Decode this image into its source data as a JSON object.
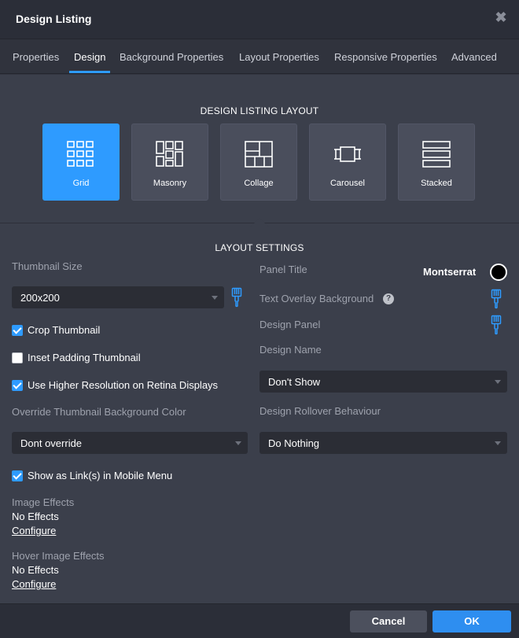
{
  "window": {
    "title": "Design Listing",
    "close_icon": "close-icon"
  },
  "tabs": [
    {
      "label": "Properties"
    },
    {
      "label": "Design"
    },
    {
      "label": "Background Properties"
    },
    {
      "label": "Layout Properties"
    },
    {
      "label": "Responsive Properties"
    },
    {
      "label": "Advanced"
    }
  ],
  "active_tab": "Design",
  "layout": {
    "heading": "DESIGN LISTING LAYOUT",
    "options": [
      {
        "label": "Grid",
        "icon": "grid-icon",
        "selected": true
      },
      {
        "label": "Masonry",
        "icon": "masonry-icon",
        "selected": false
      },
      {
        "label": "Collage",
        "icon": "collage-icon",
        "selected": false
      },
      {
        "label": "Carousel",
        "icon": "carousel-icon",
        "selected": false
      },
      {
        "label": "Stacked",
        "icon": "stacked-icon",
        "selected": false
      }
    ]
  },
  "settings": {
    "heading": "LAYOUT SETTINGS",
    "left": {
      "thumbnail_size_label": "Thumbnail Size",
      "thumbnail_size_value": "200x200",
      "crop_thumbnail": {
        "label": "Crop Thumbnail",
        "checked": true
      },
      "inset_padding": {
        "label": "Inset Padding Thumbnail",
        "checked": false
      },
      "retina": {
        "label": "Use Higher Resolution on Retina Displays",
        "checked": true
      },
      "override_bg_label": "Override Thumbnail Background Color",
      "override_bg_value": "Dont override",
      "mobile_menu": {
        "label": "Show as Link(s) in Mobile Menu",
        "checked": true
      },
      "image_effects": {
        "label": "Image Effects",
        "value": "No Effects",
        "link": "Configure"
      },
      "hover_effects": {
        "label": "Hover Image Effects",
        "value": "No Effects",
        "link": "Configure"
      }
    },
    "right": {
      "panel_title_label": "Panel Title",
      "panel_title_font": "Montserrat",
      "panel_title_color": "#000000",
      "text_overlay_label": "Text Overlay Background",
      "design_panel_label": "Design Panel",
      "design_name_label": "Design Name",
      "design_name_value": "Don't Show",
      "rollover_label": "Design Rollover Behaviour",
      "rollover_value": "Do Nothing"
    }
  },
  "footer": {
    "cancel": "Cancel",
    "ok": "OK"
  },
  "colors": {
    "accent": "#2e9bff",
    "background": "#3b3f4b"
  }
}
